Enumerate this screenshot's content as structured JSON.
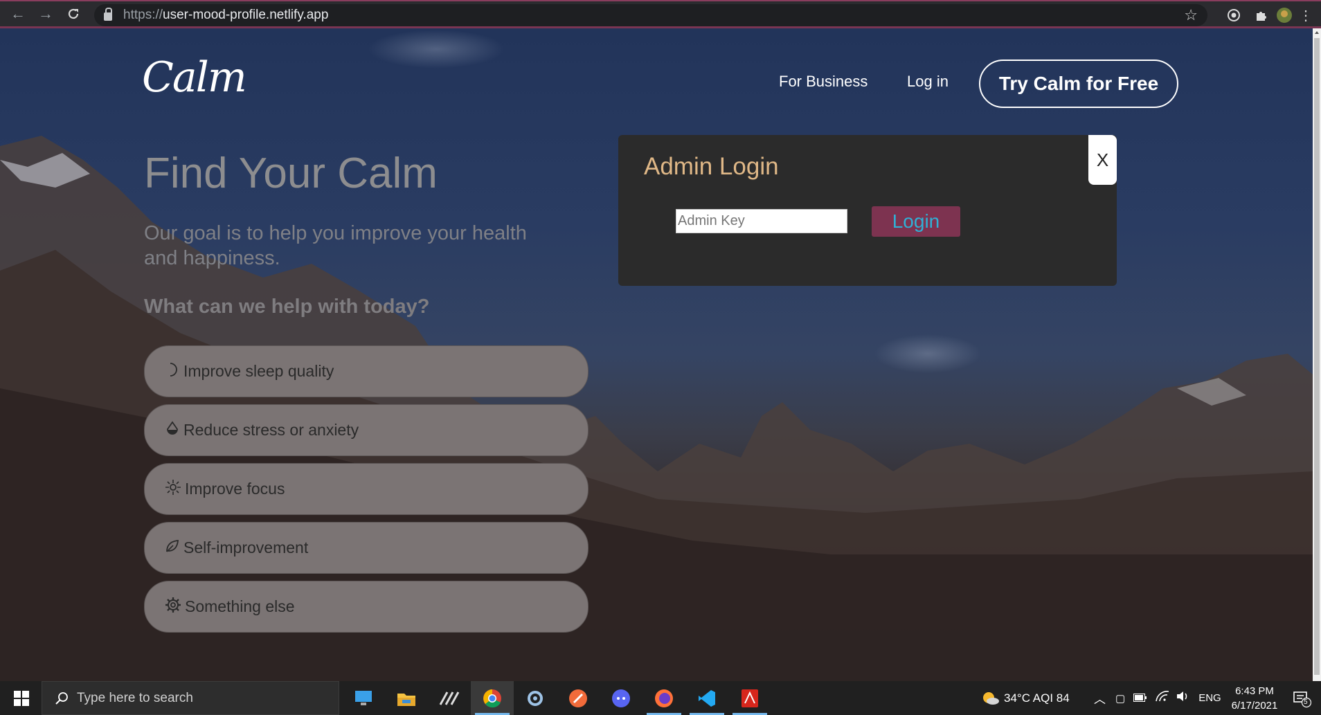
{
  "browser": {
    "url_protocol": "https://",
    "url_host": "user-mood-profile.netlify.app"
  },
  "header": {
    "logo_text": "Calm",
    "nav": [
      "For Business",
      "Log in"
    ],
    "cta_label": "Try Calm for Free"
  },
  "hero": {
    "title": "Find Your Calm",
    "subtitle": "Our goal is to help you improve your health and happiness.",
    "question": "What can we help with today?"
  },
  "options": [
    {
      "label": "Improve sleep quality",
      "icon": "moon-icon"
    },
    {
      "label": "Reduce stress or anxiety",
      "icon": "drop-icon"
    },
    {
      "label": "Improve focus",
      "icon": "focus-icon"
    },
    {
      "label": "Self-improvement",
      "icon": "leaf-icon"
    },
    {
      "label": "Something else",
      "icon": "gear-icon"
    }
  ],
  "modal": {
    "title": "Admin Login",
    "close_label": "X",
    "input_placeholder": "Admin Key",
    "login_label": "Login"
  },
  "taskbar": {
    "search_placeholder": "Type here to search",
    "weather": "34°C  AQI 84",
    "language": "ENG",
    "time": "6:43 PM",
    "date": "6/17/2021",
    "notification_count": "5"
  },
  "colors": {
    "modal_title": "#e0b887",
    "login_bg": "#7d3350",
    "login_text": "#2fb1d6",
    "option_bg": "#7b7474"
  }
}
